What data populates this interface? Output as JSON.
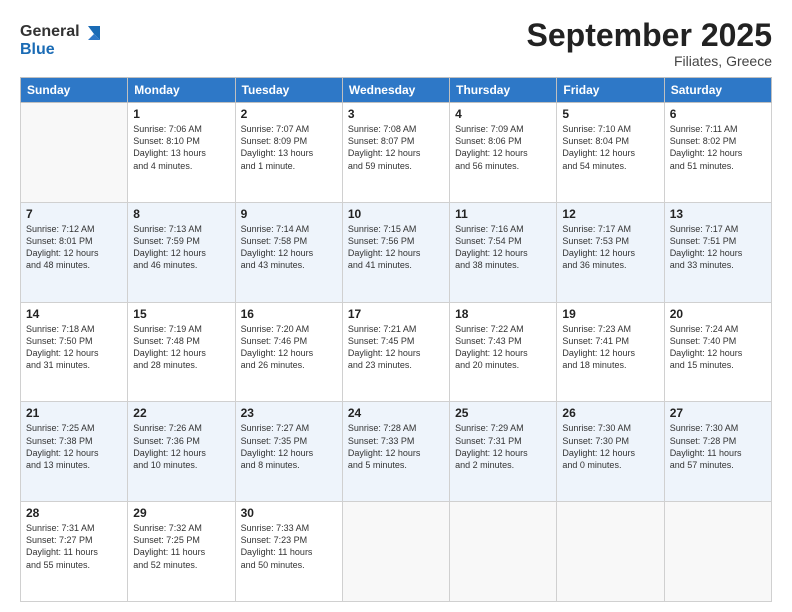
{
  "header": {
    "logo_line1": "General",
    "logo_line2": "Blue",
    "month": "September 2025",
    "location": "Filiates, Greece"
  },
  "weekdays": [
    "Sunday",
    "Monday",
    "Tuesday",
    "Wednesday",
    "Thursday",
    "Friday",
    "Saturday"
  ],
  "weeks": [
    [
      {
        "day": "",
        "lines": []
      },
      {
        "day": "1",
        "lines": [
          "Sunrise: 7:06 AM",
          "Sunset: 8:10 PM",
          "Daylight: 13 hours",
          "and 4 minutes."
        ]
      },
      {
        "day": "2",
        "lines": [
          "Sunrise: 7:07 AM",
          "Sunset: 8:09 PM",
          "Daylight: 13 hours",
          "and 1 minute."
        ]
      },
      {
        "day": "3",
        "lines": [
          "Sunrise: 7:08 AM",
          "Sunset: 8:07 PM",
          "Daylight: 12 hours",
          "and 59 minutes."
        ]
      },
      {
        "day": "4",
        "lines": [
          "Sunrise: 7:09 AM",
          "Sunset: 8:06 PM",
          "Daylight: 12 hours",
          "and 56 minutes."
        ]
      },
      {
        "day": "5",
        "lines": [
          "Sunrise: 7:10 AM",
          "Sunset: 8:04 PM",
          "Daylight: 12 hours",
          "and 54 minutes."
        ]
      },
      {
        "day": "6",
        "lines": [
          "Sunrise: 7:11 AM",
          "Sunset: 8:02 PM",
          "Daylight: 12 hours",
          "and 51 minutes."
        ]
      }
    ],
    [
      {
        "day": "7",
        "lines": [
          "Sunrise: 7:12 AM",
          "Sunset: 8:01 PM",
          "Daylight: 12 hours",
          "and 48 minutes."
        ]
      },
      {
        "day": "8",
        "lines": [
          "Sunrise: 7:13 AM",
          "Sunset: 7:59 PM",
          "Daylight: 12 hours",
          "and 46 minutes."
        ]
      },
      {
        "day": "9",
        "lines": [
          "Sunrise: 7:14 AM",
          "Sunset: 7:58 PM",
          "Daylight: 12 hours",
          "and 43 minutes."
        ]
      },
      {
        "day": "10",
        "lines": [
          "Sunrise: 7:15 AM",
          "Sunset: 7:56 PM",
          "Daylight: 12 hours",
          "and 41 minutes."
        ]
      },
      {
        "day": "11",
        "lines": [
          "Sunrise: 7:16 AM",
          "Sunset: 7:54 PM",
          "Daylight: 12 hours",
          "and 38 minutes."
        ]
      },
      {
        "day": "12",
        "lines": [
          "Sunrise: 7:17 AM",
          "Sunset: 7:53 PM",
          "Daylight: 12 hours",
          "and 36 minutes."
        ]
      },
      {
        "day": "13",
        "lines": [
          "Sunrise: 7:17 AM",
          "Sunset: 7:51 PM",
          "Daylight: 12 hours",
          "and 33 minutes."
        ]
      }
    ],
    [
      {
        "day": "14",
        "lines": [
          "Sunrise: 7:18 AM",
          "Sunset: 7:50 PM",
          "Daylight: 12 hours",
          "and 31 minutes."
        ]
      },
      {
        "day": "15",
        "lines": [
          "Sunrise: 7:19 AM",
          "Sunset: 7:48 PM",
          "Daylight: 12 hours",
          "and 28 minutes."
        ]
      },
      {
        "day": "16",
        "lines": [
          "Sunrise: 7:20 AM",
          "Sunset: 7:46 PM",
          "Daylight: 12 hours",
          "and 26 minutes."
        ]
      },
      {
        "day": "17",
        "lines": [
          "Sunrise: 7:21 AM",
          "Sunset: 7:45 PM",
          "Daylight: 12 hours",
          "and 23 minutes."
        ]
      },
      {
        "day": "18",
        "lines": [
          "Sunrise: 7:22 AM",
          "Sunset: 7:43 PM",
          "Daylight: 12 hours",
          "and 20 minutes."
        ]
      },
      {
        "day": "19",
        "lines": [
          "Sunrise: 7:23 AM",
          "Sunset: 7:41 PM",
          "Daylight: 12 hours",
          "and 18 minutes."
        ]
      },
      {
        "day": "20",
        "lines": [
          "Sunrise: 7:24 AM",
          "Sunset: 7:40 PM",
          "Daylight: 12 hours",
          "and 15 minutes."
        ]
      }
    ],
    [
      {
        "day": "21",
        "lines": [
          "Sunrise: 7:25 AM",
          "Sunset: 7:38 PM",
          "Daylight: 12 hours",
          "and 13 minutes."
        ]
      },
      {
        "day": "22",
        "lines": [
          "Sunrise: 7:26 AM",
          "Sunset: 7:36 PM",
          "Daylight: 12 hours",
          "and 10 minutes."
        ]
      },
      {
        "day": "23",
        "lines": [
          "Sunrise: 7:27 AM",
          "Sunset: 7:35 PM",
          "Daylight: 12 hours",
          "and 8 minutes."
        ]
      },
      {
        "day": "24",
        "lines": [
          "Sunrise: 7:28 AM",
          "Sunset: 7:33 PM",
          "Daylight: 12 hours",
          "and 5 minutes."
        ]
      },
      {
        "day": "25",
        "lines": [
          "Sunrise: 7:29 AM",
          "Sunset: 7:31 PM",
          "Daylight: 12 hours",
          "and 2 minutes."
        ]
      },
      {
        "day": "26",
        "lines": [
          "Sunrise: 7:30 AM",
          "Sunset: 7:30 PM",
          "Daylight: 12 hours",
          "and 0 minutes."
        ]
      },
      {
        "day": "27",
        "lines": [
          "Sunrise: 7:30 AM",
          "Sunset: 7:28 PM",
          "Daylight: 11 hours",
          "and 57 minutes."
        ]
      }
    ],
    [
      {
        "day": "28",
        "lines": [
          "Sunrise: 7:31 AM",
          "Sunset: 7:27 PM",
          "Daylight: 11 hours",
          "and 55 minutes."
        ]
      },
      {
        "day": "29",
        "lines": [
          "Sunrise: 7:32 AM",
          "Sunset: 7:25 PM",
          "Daylight: 11 hours",
          "and 52 minutes."
        ]
      },
      {
        "day": "30",
        "lines": [
          "Sunrise: 7:33 AM",
          "Sunset: 7:23 PM",
          "Daylight: 11 hours",
          "and 50 minutes."
        ]
      },
      {
        "day": "",
        "lines": []
      },
      {
        "day": "",
        "lines": []
      },
      {
        "day": "",
        "lines": []
      },
      {
        "day": "",
        "lines": []
      }
    ]
  ]
}
